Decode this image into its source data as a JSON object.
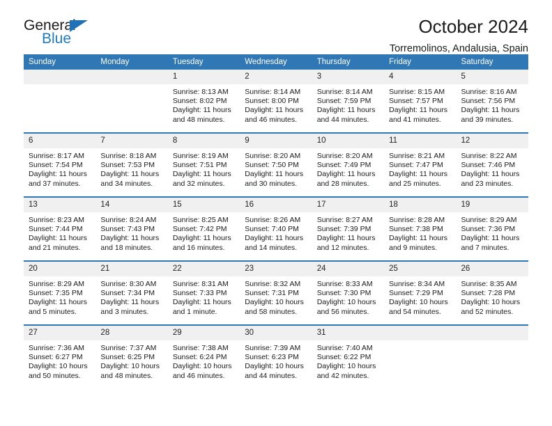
{
  "brand": {
    "name_part1": "General",
    "name_part2": "Blue",
    "triangle_color": "#1f72b8",
    "blue_color": "#1f7bc4"
  },
  "header": {
    "title": "October 2024",
    "subtitle": "Torremolinos, Andalusia, Spain",
    "header_bg": "#3077b5",
    "header_text_color": "#ffffff",
    "daynum_bg": "#f0f0f0"
  },
  "weekdays": [
    "Sunday",
    "Monday",
    "Tuesday",
    "Wednesday",
    "Thursday",
    "Friday",
    "Saturday"
  ],
  "labels": {
    "sunrise_prefix": "Sunrise: ",
    "sunset_prefix": "Sunset: ",
    "daylight_prefix": "Daylight: "
  },
  "weeks": [
    [
      {
        "day": "",
        "empty": true
      },
      {
        "day": "",
        "empty": true
      },
      {
        "day": "1",
        "sunrise": "Sunrise: 8:13 AM",
        "sunset": "Sunset: 8:02 PM",
        "daylight_line1": "Daylight: 11 hours",
        "daylight_line2": "and 48 minutes."
      },
      {
        "day": "2",
        "sunrise": "Sunrise: 8:14 AM",
        "sunset": "Sunset: 8:00 PM",
        "daylight_line1": "Daylight: 11 hours",
        "daylight_line2": "and 46 minutes."
      },
      {
        "day": "3",
        "sunrise": "Sunrise: 8:14 AM",
        "sunset": "Sunset: 7:59 PM",
        "daylight_line1": "Daylight: 11 hours",
        "daylight_line2": "and 44 minutes."
      },
      {
        "day": "4",
        "sunrise": "Sunrise: 8:15 AM",
        "sunset": "Sunset: 7:57 PM",
        "daylight_line1": "Daylight: 11 hours",
        "daylight_line2": "and 41 minutes."
      },
      {
        "day": "5",
        "sunrise": "Sunrise: 8:16 AM",
        "sunset": "Sunset: 7:56 PM",
        "daylight_line1": "Daylight: 11 hours",
        "daylight_line2": "and 39 minutes."
      }
    ],
    [
      {
        "day": "6",
        "sunrise": "Sunrise: 8:17 AM",
        "sunset": "Sunset: 7:54 PM",
        "daylight_line1": "Daylight: 11 hours",
        "daylight_line2": "and 37 minutes."
      },
      {
        "day": "7",
        "sunrise": "Sunrise: 8:18 AM",
        "sunset": "Sunset: 7:53 PM",
        "daylight_line1": "Daylight: 11 hours",
        "daylight_line2": "and 34 minutes."
      },
      {
        "day": "8",
        "sunrise": "Sunrise: 8:19 AM",
        "sunset": "Sunset: 7:51 PM",
        "daylight_line1": "Daylight: 11 hours",
        "daylight_line2": "and 32 minutes."
      },
      {
        "day": "9",
        "sunrise": "Sunrise: 8:20 AM",
        "sunset": "Sunset: 7:50 PM",
        "daylight_line1": "Daylight: 11 hours",
        "daylight_line2": "and 30 minutes."
      },
      {
        "day": "10",
        "sunrise": "Sunrise: 8:20 AM",
        "sunset": "Sunset: 7:49 PM",
        "daylight_line1": "Daylight: 11 hours",
        "daylight_line2": "and 28 minutes."
      },
      {
        "day": "11",
        "sunrise": "Sunrise: 8:21 AM",
        "sunset": "Sunset: 7:47 PM",
        "daylight_line1": "Daylight: 11 hours",
        "daylight_line2": "and 25 minutes."
      },
      {
        "day": "12",
        "sunrise": "Sunrise: 8:22 AM",
        "sunset": "Sunset: 7:46 PM",
        "daylight_line1": "Daylight: 11 hours",
        "daylight_line2": "and 23 minutes."
      }
    ],
    [
      {
        "day": "13",
        "sunrise": "Sunrise: 8:23 AM",
        "sunset": "Sunset: 7:44 PM",
        "daylight_line1": "Daylight: 11 hours",
        "daylight_line2": "and 21 minutes."
      },
      {
        "day": "14",
        "sunrise": "Sunrise: 8:24 AM",
        "sunset": "Sunset: 7:43 PM",
        "daylight_line1": "Daylight: 11 hours",
        "daylight_line2": "and 18 minutes."
      },
      {
        "day": "15",
        "sunrise": "Sunrise: 8:25 AM",
        "sunset": "Sunset: 7:42 PM",
        "daylight_line1": "Daylight: 11 hours",
        "daylight_line2": "and 16 minutes."
      },
      {
        "day": "16",
        "sunrise": "Sunrise: 8:26 AM",
        "sunset": "Sunset: 7:40 PM",
        "daylight_line1": "Daylight: 11 hours",
        "daylight_line2": "and 14 minutes."
      },
      {
        "day": "17",
        "sunrise": "Sunrise: 8:27 AM",
        "sunset": "Sunset: 7:39 PM",
        "daylight_line1": "Daylight: 11 hours",
        "daylight_line2": "and 12 minutes."
      },
      {
        "day": "18",
        "sunrise": "Sunrise: 8:28 AM",
        "sunset": "Sunset: 7:38 PM",
        "daylight_line1": "Daylight: 11 hours",
        "daylight_line2": "and 9 minutes."
      },
      {
        "day": "19",
        "sunrise": "Sunrise: 8:29 AM",
        "sunset": "Sunset: 7:36 PM",
        "daylight_line1": "Daylight: 11 hours",
        "daylight_line2": "and 7 minutes."
      }
    ],
    [
      {
        "day": "20",
        "sunrise": "Sunrise: 8:29 AM",
        "sunset": "Sunset: 7:35 PM",
        "daylight_line1": "Daylight: 11 hours",
        "daylight_line2": "and 5 minutes."
      },
      {
        "day": "21",
        "sunrise": "Sunrise: 8:30 AM",
        "sunset": "Sunset: 7:34 PM",
        "daylight_line1": "Daylight: 11 hours",
        "daylight_line2": "and 3 minutes."
      },
      {
        "day": "22",
        "sunrise": "Sunrise: 8:31 AM",
        "sunset": "Sunset: 7:33 PM",
        "daylight_line1": "Daylight: 11 hours",
        "daylight_line2": "and 1 minute."
      },
      {
        "day": "23",
        "sunrise": "Sunrise: 8:32 AM",
        "sunset": "Sunset: 7:31 PM",
        "daylight_line1": "Daylight: 10 hours",
        "daylight_line2": "and 58 minutes."
      },
      {
        "day": "24",
        "sunrise": "Sunrise: 8:33 AM",
        "sunset": "Sunset: 7:30 PM",
        "daylight_line1": "Daylight: 10 hours",
        "daylight_line2": "and 56 minutes."
      },
      {
        "day": "25",
        "sunrise": "Sunrise: 8:34 AM",
        "sunset": "Sunset: 7:29 PM",
        "daylight_line1": "Daylight: 10 hours",
        "daylight_line2": "and 54 minutes."
      },
      {
        "day": "26",
        "sunrise": "Sunrise: 8:35 AM",
        "sunset": "Sunset: 7:28 PM",
        "daylight_line1": "Daylight: 10 hours",
        "daylight_line2": "and 52 minutes."
      }
    ],
    [
      {
        "day": "27",
        "sunrise": "Sunrise: 7:36 AM",
        "sunset": "Sunset: 6:27 PM",
        "daylight_line1": "Daylight: 10 hours",
        "daylight_line2": "and 50 minutes."
      },
      {
        "day": "28",
        "sunrise": "Sunrise: 7:37 AM",
        "sunset": "Sunset: 6:25 PM",
        "daylight_line1": "Daylight: 10 hours",
        "daylight_line2": "and 48 minutes."
      },
      {
        "day": "29",
        "sunrise": "Sunrise: 7:38 AM",
        "sunset": "Sunset: 6:24 PM",
        "daylight_line1": "Daylight: 10 hours",
        "daylight_line2": "and 46 minutes."
      },
      {
        "day": "30",
        "sunrise": "Sunrise: 7:39 AM",
        "sunset": "Sunset: 6:23 PM",
        "daylight_line1": "Daylight: 10 hours",
        "daylight_line2": "and 44 minutes."
      },
      {
        "day": "31",
        "sunrise": "Sunrise: 7:40 AM",
        "sunset": "Sunset: 6:22 PM",
        "daylight_line1": "Daylight: 10 hours",
        "daylight_line2": "and 42 minutes."
      },
      {
        "day": "",
        "empty": true
      },
      {
        "day": "",
        "empty": true
      }
    ]
  ]
}
